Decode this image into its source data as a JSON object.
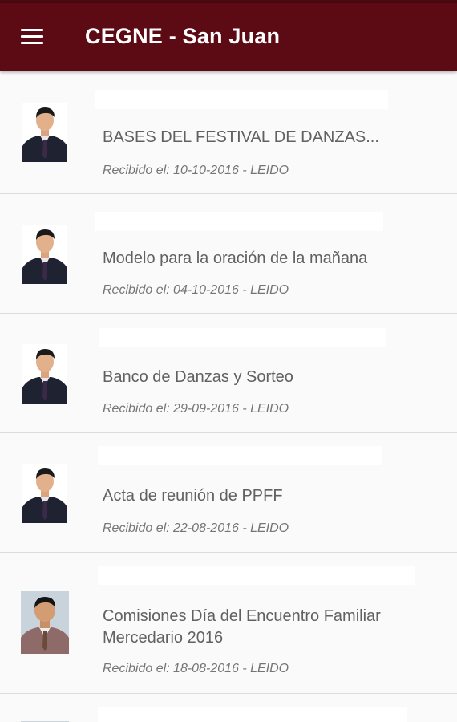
{
  "app": {
    "title": "CEGNE - San Juan",
    "menu_icon": "hamburger-menu-icon",
    "colors": {
      "appbar": "#5c0a14",
      "background": "#fafafa",
      "subject_text": "#616161",
      "meta_text": "#757575"
    }
  },
  "messages": [
    {
      "subject": "BASES DEL FESTIVAL DE DANZAS...",
      "received": "Recibido el: 10-10-2016 - LEIDO",
      "avatar": "profile-photo-icon"
    },
    {
      "subject": "Modelo para la oración de la mañana",
      "received": "Recibido el: 04-10-2016 - LEIDO",
      "avatar": "profile-photo-icon"
    },
    {
      "subject": "Banco de Danzas y Sorteo",
      "received": "Recibido el: 29-09-2016 - LEIDO",
      "avatar": "profile-photo-icon"
    },
    {
      "subject": "Acta de reunión de PPFF",
      "received": "Recibido el: 22-08-2016 - LEIDO",
      "avatar": "profile-photo-icon"
    },
    {
      "subject": "Comisiones Día del Encuentro Familiar Mercedario 2016",
      "received": "Recibido el: 18-08-2016 - LEIDO",
      "avatar": "profile-photo-icon"
    }
  ]
}
